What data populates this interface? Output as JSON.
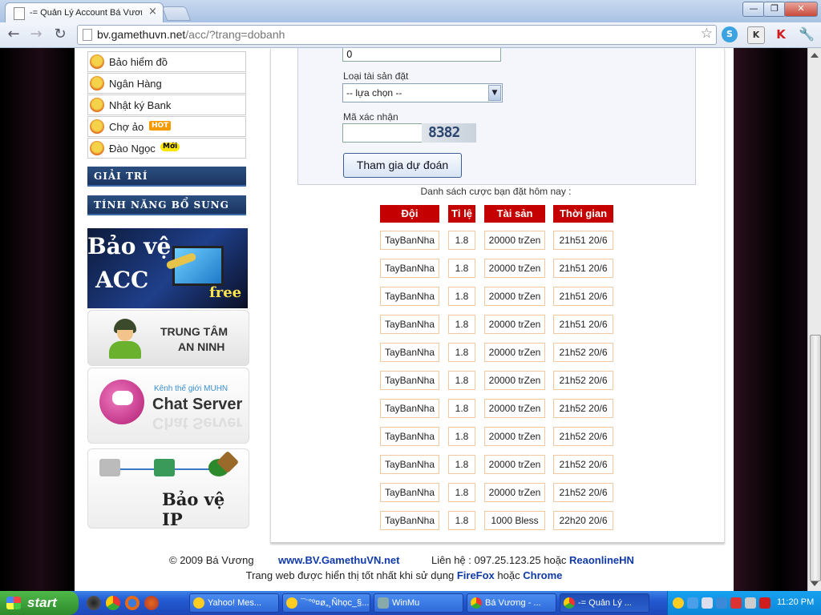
{
  "browser": {
    "tab_title": "-= Quản Lý Account Bá Vươn",
    "url_host": "bv.gamethuvn.net",
    "url_path": "/acc/?trang=dobanh",
    "window_buttons": {
      "minimize": "—",
      "restore": "❐",
      "close": "✕"
    }
  },
  "sidebar": {
    "menu_items": [
      {
        "label": "Bảo hiểm đồ"
      },
      {
        "label": "Ngân Hàng"
      },
      {
        "label": "Nhật ký Bank"
      },
      {
        "label": "Chợ ảo",
        "badge": "HOT"
      },
      {
        "label": "Đào Ngọc",
        "badge": "Mới"
      }
    ],
    "sections": [
      "GIẢI TRÍ",
      "TÍNH NĂNG BỔ SUNG"
    ],
    "banners": {
      "protect_acc": {
        "line1": "Bảo vệ",
        "line2": "ACC",
        "line3": "free"
      },
      "security": {
        "line1": "TRUNG TÂM",
        "line2": "AN NINH"
      },
      "chat": {
        "kicker": "Kênh thế giới MUHN",
        "title": "Chat Server"
      },
      "ip": {
        "title": "Bảo vệ IP"
      }
    }
  },
  "form": {
    "amount_value": "0",
    "asset_type_label": "Loại tài sản đặt",
    "asset_type_selected": "-- lựa chọn --",
    "captcha_label": "Mã xác nhận",
    "captcha_value": "",
    "captcha_image_text": "8382",
    "submit_label": "Tham gia dự đoán"
  },
  "bets": {
    "title": "Danh sách cược bạn đặt hôm nay :",
    "columns": [
      "Đội",
      "Tỉ lệ",
      "Tài sản",
      "Thời gian"
    ],
    "rows": [
      [
        "TayBanNha",
        "1.8",
        "20000 trZen",
        "21h51  20/6"
      ],
      [
        "TayBanNha",
        "1.8",
        "20000 trZen",
        "21h51  20/6"
      ],
      [
        "TayBanNha",
        "1.8",
        "20000 trZen",
        "21h51  20/6"
      ],
      [
        "TayBanNha",
        "1.8",
        "20000 trZen",
        "21h51  20/6"
      ],
      [
        "TayBanNha",
        "1.8",
        "20000 trZen",
        "21h52  20/6"
      ],
      [
        "TayBanNha",
        "1.8",
        "20000 trZen",
        "21h52  20/6"
      ],
      [
        "TayBanNha",
        "1.8",
        "20000 trZen",
        "21h52  20/6"
      ],
      [
        "TayBanNha",
        "1.8",
        "20000 trZen",
        "21h52  20/6"
      ],
      [
        "TayBanNha",
        "1.8",
        "20000 trZen",
        "21h52  20/6"
      ],
      [
        "TayBanNha",
        "1.8",
        "20000 trZen",
        "21h52  20/6"
      ],
      [
        "TayBanNha",
        "1.8",
        "1000 Bless",
        "22h20  20/6"
      ]
    ]
  },
  "footer": {
    "copyright": "© 2009 Bá Vương",
    "site_link": "www.BV.GamethuVN.net",
    "contact_prefix": "Liên hệ : 097.25.123.25 hoặc",
    "contact_link": "ReaonlineHN",
    "note_prefix": "Trang web được hiển thị tốt nhất khi sử dụng",
    "browser1": "FireFox",
    "note_mid": "hoặc",
    "browser2": "Chrome"
  },
  "taskbar": {
    "start_label": "start",
    "tasks": [
      "Yahoo! Mes...",
      "¯¨°º¤ø„¸Ñhọc_§...",
      "WinMu",
      "Bá Vương - ...",
      "-= Quản Lý ..."
    ],
    "clock": "11:20 PM"
  },
  "colors": {
    "accent_red": "#c40000",
    "nav_blue": "#1a3561",
    "link_blue": "#103aa8"
  }
}
